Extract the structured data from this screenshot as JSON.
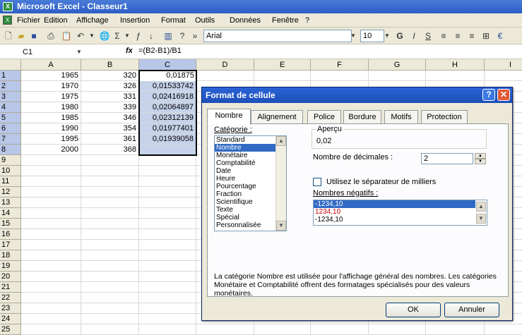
{
  "app": {
    "title": "Microsoft Excel - Classeur1",
    "icon_text": "X"
  },
  "menubar": {
    "items": [
      "Fichier",
      "Edition",
      "Affichage",
      "Insertion",
      "Format",
      "Outils",
      "Données",
      "Fenêtre",
      "?"
    ]
  },
  "toolbar": {
    "font_name": "Arial",
    "font_size": "10",
    "bold": "G",
    "italic": "I",
    "underline": "S"
  },
  "formula_bar": {
    "name_box": "C1",
    "fx": "fx",
    "formula": "=(B2-B1)/B1"
  },
  "grid": {
    "columns": [
      "A",
      "B",
      "C",
      "D",
      "E",
      "F",
      "G",
      "H",
      "I"
    ],
    "rows": [
      "1",
      "2",
      "3",
      "4",
      "5",
      "6",
      "7",
      "8",
      "9",
      "10",
      "11",
      "12",
      "13",
      "14",
      "15",
      "16",
      "17",
      "18",
      "19",
      "20",
      "21",
      "22",
      "23",
      "24",
      "25"
    ],
    "data": [
      [
        "1965",
        "320",
        "0,01875"
      ],
      [
        "1970",
        "326",
        "0,01533742"
      ],
      [
        "1975",
        "331",
        "0,02416918"
      ],
      [
        "1980",
        "339",
        "0,02064897"
      ],
      [
        "1985",
        "346",
        "0,02312139"
      ],
      [
        "1990",
        "354",
        "0,01977401"
      ],
      [
        "1995",
        "361",
        "0,01939058"
      ],
      [
        "2000",
        "368",
        ""
      ]
    ]
  },
  "dialog": {
    "title": "Format de cellule",
    "help": "?",
    "close": "✕",
    "tabs": [
      "Nombre",
      "Alignement",
      "Police",
      "Bordure",
      "Motifs",
      "Protection"
    ],
    "category_label": "Catégorie :",
    "categories": [
      "Standard",
      "Nombre",
      "Monétaire",
      "Comptabilité",
      "Date",
      "Heure",
      "Pourcentage",
      "Fraction",
      "Scientifique",
      "Texte",
      "Spécial",
      "Personnalisée"
    ],
    "selected_category": "Nombre",
    "preview_label": "Aperçu",
    "preview_value": "0,02",
    "decimals_label": "Nombre de décimales :",
    "decimals_value": "2",
    "separator_label": "Utilisez le séparateur de milliers",
    "negative_label": "Nombres négatifs :",
    "negatives": [
      {
        "text": "-1234,10",
        "color": "#000000",
        "selected": true
      },
      {
        "text": "1234,10",
        "color": "#cc0000",
        "selected": false
      },
      {
        "text": "-1234,10",
        "color": "#000000",
        "selected": false
      }
    ],
    "description": "La catégorie Nombre est utilisée pour l'affichage général des nombres. Les catégories Monétaire et Comptabilité offrent des formatages spécialisés pour des valeurs monétaires.",
    "ok_label": "OK",
    "cancel_label": "Annuler"
  }
}
